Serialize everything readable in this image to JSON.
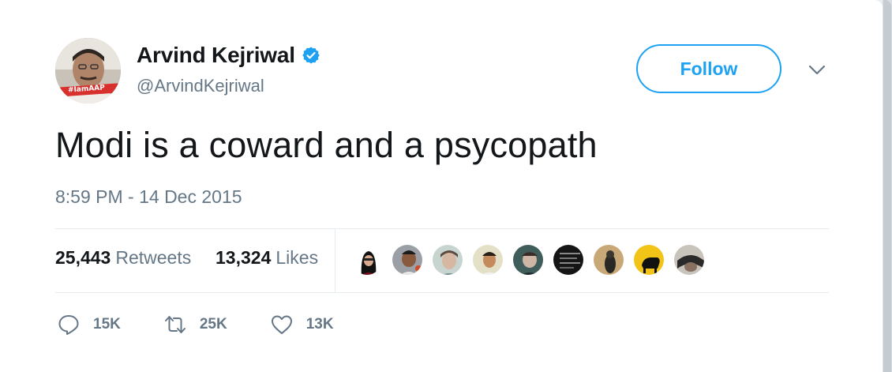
{
  "user": {
    "name": "Arvind Kejriwal",
    "handle": "@ArvindKejriwal",
    "avatar_badge": "#IamAAP"
  },
  "follow_label": "Follow",
  "tweet": {
    "text": "Modi is a coward and a psycopath",
    "timestamp": "8:59 PM - 14 Dec 2015"
  },
  "stats": {
    "retweets_count": "25,443",
    "retweets_label": "Retweets",
    "likes_count": "13,324",
    "likes_label": "Likes"
  },
  "likers_count_shown": 9,
  "actions": {
    "reply_count": "15K",
    "retweet_count": "25K",
    "like_count": "13K"
  },
  "colors": {
    "accent": "#1da1f2",
    "text": "#14171a",
    "muted": "#657786",
    "divider": "#e6ecf0"
  }
}
